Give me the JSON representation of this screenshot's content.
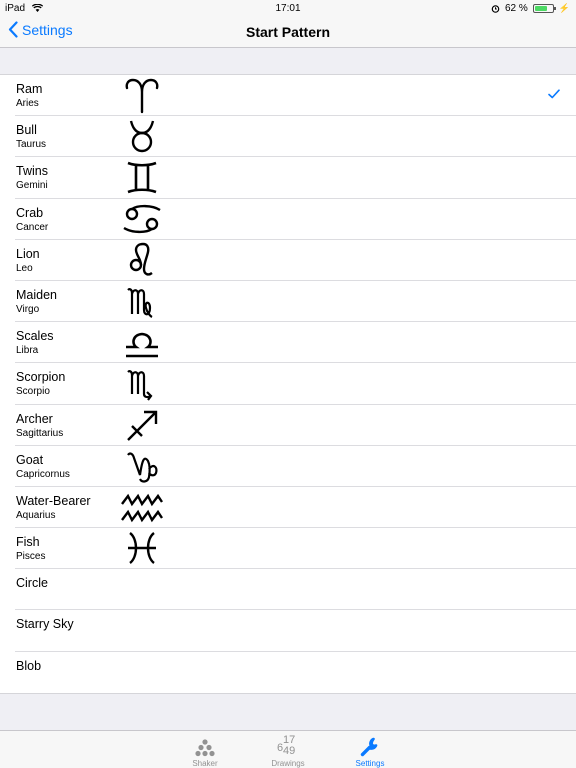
{
  "status_bar": {
    "device": "iPad",
    "time": "17:01",
    "battery": "62 %"
  },
  "nav": {
    "back_label": "Settings",
    "title": "Start Pattern"
  },
  "rows": [
    {
      "title": "Ram",
      "subtitle": "Aries",
      "icon": "aries-icon",
      "selected": true
    },
    {
      "title": "Bull",
      "subtitle": "Taurus",
      "icon": "taurus-icon"
    },
    {
      "title": "Twins",
      "subtitle": "Gemini",
      "icon": "gemini-icon"
    },
    {
      "title": "Crab",
      "subtitle": "Cancer",
      "icon": "cancer-icon"
    },
    {
      "title": "Lion",
      "subtitle": "Leo",
      "icon": "leo-icon"
    },
    {
      "title": "Maiden",
      "subtitle": "Virgo",
      "icon": "virgo-icon"
    },
    {
      "title": "Scales",
      "subtitle": "Libra",
      "icon": "libra-icon"
    },
    {
      "title": "Scorpion",
      "subtitle": "Scorpio",
      "icon": "scorpio-icon"
    },
    {
      "title": "Archer",
      "subtitle": "Sagittarius",
      "icon": "sagittarius-icon"
    },
    {
      "title": "Goat",
      "subtitle": "Capricornus",
      "icon": "capricorn-icon"
    },
    {
      "title": "Water-Bearer",
      "subtitle": "Aquarius",
      "icon": "aquarius-icon"
    },
    {
      "title": "Fish",
      "subtitle": "Pisces",
      "icon": "pisces-icon"
    },
    {
      "title": "Circle"
    },
    {
      "title": "Starry Sky"
    },
    {
      "title": "Blob"
    }
  ],
  "tabs": [
    {
      "label": "Shaker",
      "icon": "shaker-icon"
    },
    {
      "label": "Drawings",
      "icon": "drawings-icon",
      "icon_text": [
        "6",
        "17",
        "49"
      ]
    },
    {
      "label": "Settings",
      "icon": "wrench-icon",
      "active": true
    }
  ],
  "colors": {
    "accent": "#0a7aff",
    "background": "#efeff4",
    "inactive": "#929292"
  }
}
